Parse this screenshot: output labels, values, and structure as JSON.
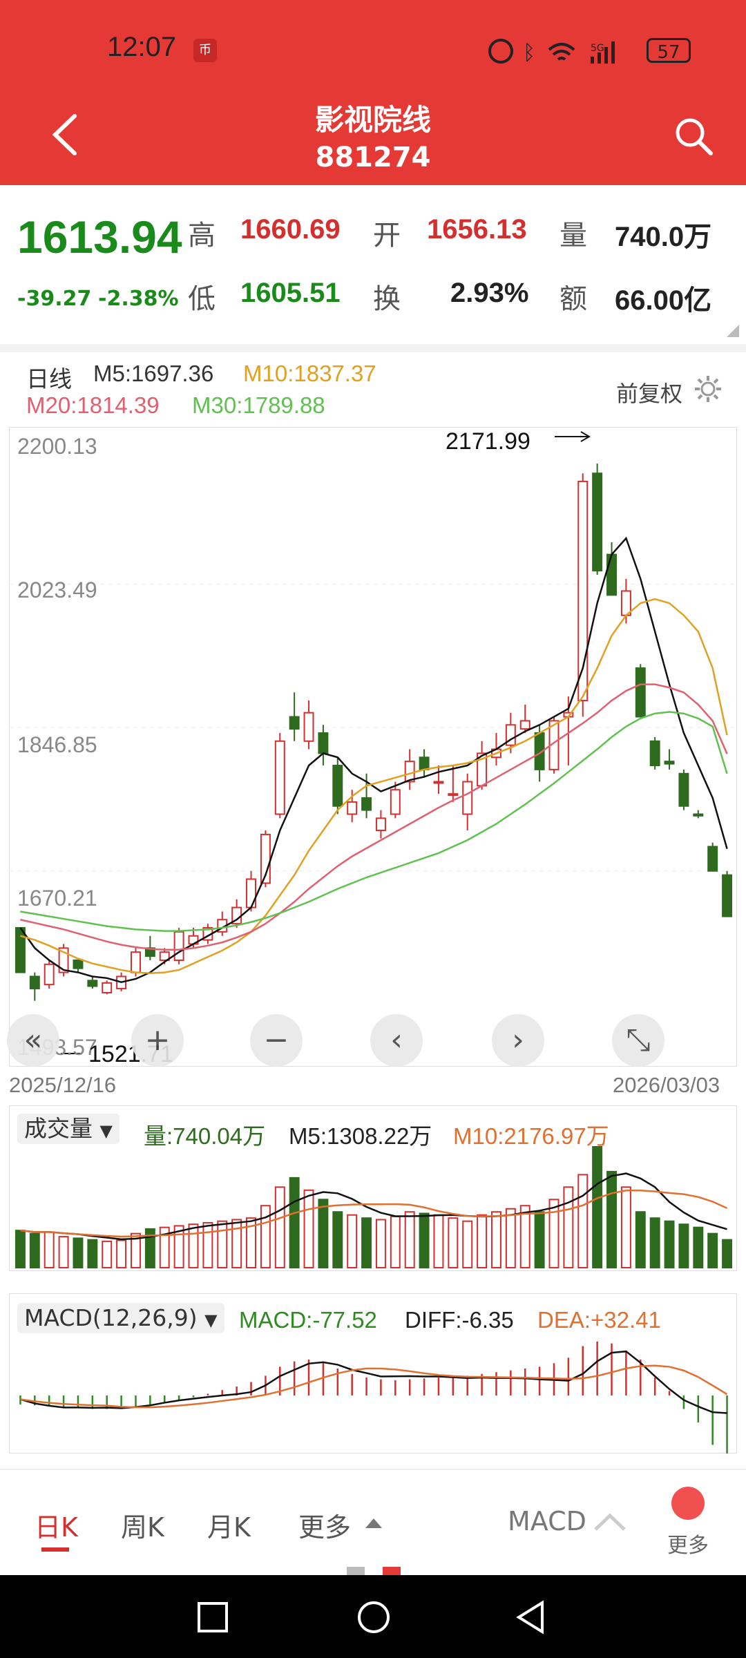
{
  "status": {
    "time": "12:07",
    "battery": "57"
  },
  "header": {
    "title": "影视院线",
    "code": "881274"
  },
  "quote": {
    "price": "1613.94",
    "change": "-39.27",
    "change_pct": "-2.38%",
    "high_label": "高",
    "high": "1660.69",
    "open_label": "开",
    "open": "1656.13",
    "volume_label": "量",
    "volume": "740.0万",
    "low_label": "低",
    "low": "1605.51",
    "turnover_label": "换",
    "turnover": "2.93%",
    "amount_label": "额",
    "amount": "66.00亿"
  },
  "kline": {
    "period": "日线",
    "m5": "M5:1697.36",
    "m10": "M10:1837.37",
    "m20": "M20:1814.39",
    "m30": "M30:1789.88",
    "adjust": "前复权",
    "y_ticks": [
      "2200.13",
      "2023.49",
      "1846.85",
      "1670.21",
      "1493.57"
    ],
    "max_label": "2171.99",
    "min_label": "1521.71",
    "start_date": "2025/12/16",
    "end_date": "2026/03/03"
  },
  "volume_panel": {
    "selector": "成交量",
    "vol": "量:740.04万",
    "m5": "M5:1308.22万",
    "m10": "M10:2176.97万"
  },
  "macd_panel": {
    "selector": "MACD(12,26,9)",
    "macd": "MACD:-77.52",
    "diff": "DIFF:-6.35",
    "dea": "DEA:+32.41"
  },
  "tabs": {
    "day": "日K",
    "week": "周K",
    "month": "月K",
    "more": "更多",
    "indicator": "MACD",
    "more2": "更多"
  },
  "colors": {
    "up": "#d32f2f",
    "down": "#2e6b1f",
    "ma5": "#111111",
    "ma10": "#e0a020",
    "ma20": "#e06070",
    "ma30": "#60c050",
    "header": "#e53935"
  },
  "chart_data": {
    "type": "candlestick",
    "ylim": [
      1493.57,
      2200.13
    ],
    "ohlc": [
      [
        1600,
        1600,
        1545,
        1545
      ],
      [
        1540,
        1545,
        1510,
        1525
      ],
      [
        1530,
        1560,
        1525,
        1555
      ],
      [
        1545,
        1580,
        1540,
        1575
      ],
      [
        1560,
        1560,
        1545,
        1550
      ],
      [
        1535,
        1540,
        1525,
        1528
      ],
      [
        1520,
        1535,
        1518,
        1532
      ],
      [
        1525,
        1545,
        1521.71,
        1540
      ],
      [
        1545,
        1575,
        1540,
        1570
      ],
      [
        1575,
        1590,
        1560,
        1565
      ],
      [
        1560,
        1575,
        1555,
        1570
      ],
      [
        1560,
        1600,
        1555,
        1595
      ],
      [
        1580,
        1600,
        1575,
        1590
      ],
      [
        1585,
        1605,
        1580,
        1600
      ],
      [
        1595,
        1620,
        1590,
        1610
      ],
      [
        1605,
        1635,
        1600,
        1625
      ],
      [
        1625,
        1670,
        1620,
        1660
      ],
      [
        1655,
        1720,
        1650,
        1715
      ],
      [
        1740,
        1840,
        1735,
        1830
      ],
      [
        1860,
        1890,
        1830,
        1845
      ],
      [
        1830,
        1880,
        1820,
        1865
      ],
      [
        1840,
        1850,
        1800,
        1815
      ],
      [
        1800,
        1810,
        1740,
        1750
      ],
      [
        1740,
        1770,
        1730,
        1755
      ],
      [
        1760,
        1790,
        1735,
        1745
      ],
      [
        1720,
        1745,
        1710,
        1735
      ],
      [
        1740,
        1780,
        1735,
        1770
      ],
      [
        1780,
        1820,
        1770,
        1805
      ],
      [
        1810,
        1820,
        1785,
        1795
      ],
      [
        1780,
        1800,
        1765,
        1780
      ],
      [
        1765,
        1800,
        1755,
        1765
      ],
      [
        1740,
        1790,
        1720,
        1780
      ],
      [
        1775,
        1830,
        1770,
        1815
      ],
      [
        1810,
        1840,
        1800,
        1820
      ],
      [
        1825,
        1865,
        1815,
        1850
      ],
      [
        1845,
        1875,
        1840,
        1855
      ],
      [
        1840,
        1850,
        1780,
        1795
      ],
      [
        1795,
        1860,
        1790,
        1855
      ],
      [
        1860,
        1885,
        1800,
        1865
      ],
      [
        1880,
        2160,
        1860,
        2150
      ],
      [
        2160,
        2171.99,
        2035,
        2040
      ],
      [
        2060,
        2075,
        2010,
        2010
      ],
      [
        1985,
        2030,
        1975,
        2015
      ],
      [
        1920,
        1925,
        1865,
        1860
      ],
      [
        1830,
        1835,
        1795,
        1800
      ],
      [
        1805,
        1820,
        1795,
        1802
      ],
      [
        1790,
        1795,
        1745,
        1750
      ],
      [
        1740,
        1745,
        1735,
        1738
      ],
      [
        1700,
        1705,
        1670,
        1670
      ],
      [
        1665,
        1670,
        1615,
        1613.94
      ]
    ],
    "series": [
      {
        "name": "M5",
        "values": [
          1600,
          1575,
          1560,
          1548,
          1545,
          1540,
          1538,
          1533,
          1537,
          1545,
          1558,
          1570,
          1580,
          1590,
          1600,
          1610,
          1625,
          1665,
          1720,
          1760,
          1800,
          1815,
          1810,
          1790,
          1780,
          1768,
          1775,
          1782,
          1786,
          1792,
          1796,
          1800,
          1812,
          1820,
          1832,
          1842,
          1850,
          1860,
          1870,
          1920,
          2000,
          2060,
          2080,
          2030,
          1965,
          1900,
          1840,
          1800,
          1760,
          1697.36
        ]
      },
      {
        "name": "M10",
        "values": [
          1590,
          1585,
          1578,
          1570,
          1562,
          1556,
          1552,
          1548,
          1545,
          1544,
          1545,
          1548,
          1556,
          1564,
          1572,
          1582,
          1595,
          1615,
          1640,
          1665,
          1695,
          1720,
          1745,
          1762,
          1775,
          1780,
          1785,
          1790,
          1795,
          1798,
          1800,
          1803,
          1808,
          1815,
          1822,
          1830,
          1840,
          1850,
          1860,
          1885,
          1920,
          1960,
          1985,
          2000,
          2005,
          2000,
          1985,
          1965,
          1920,
          1837.37
        ]
      },
      {
        "name": "M20",
        "values": [
          1610,
          1606,
          1602,
          1598,
          1593,
          1588,
          1583,
          1579,
          1576,
          1574,
          1573,
          1573,
          1575,
          1578,
          1582,
          1588,
          1595,
          1605,
          1618,
          1632,
          1648,
          1662,
          1676,
          1688,
          1698,
          1708,
          1718,
          1728,
          1738,
          1748,
          1757,
          1765,
          1775,
          1785,
          1795,
          1805,
          1815,
          1828,
          1840,
          1852,
          1865,
          1880,
          1892,
          1900,
          1900,
          1896,
          1890,
          1875,
          1855,
          1814.39
        ]
      },
      {
        "name": "M30",
        "values": [
          1620,
          1617,
          1614,
          1611,
          1608,
          1605,
          1602,
          1600,
          1598,
          1597,
          1596,
          1596,
          1597,
          1598,
          1600,
          1603,
          1607,
          1612,
          1618,
          1625,
          1632,
          1640,
          1648,
          1655,
          1662,
          1668,
          1674,
          1680,
          1686,
          1692,
          1700,
          1708,
          1718,
          1728,
          1740,
          1752,
          1765,
          1778,
          1792,
          1806,
          1820,
          1835,
          1848,
          1858,
          1864,
          1866,
          1864,
          1858,
          1848,
          1789.88
        ]
      }
    ],
    "volume": [
      120,
      110,
      115,
      100,
      95,
      90,
      85,
      88,
      110,
      125,
      130,
      135,
      140,
      145,
      150,
      155,
      160,
      200,
      260,
      290,
      250,
      220,
      180,
      170,
      160,
      155,
      165,
      180,
      175,
      170,
      160,
      150,
      170,
      180,
      190,
      200,
      180,
      220,
      260,
      300,
      390,
      310,
      260,
      180,
      160,
      150,
      140,
      130,
      110,
      90
    ],
    "macd": [
      -10,
      -11,
      -12,
      -13,
      -14,
      -15,
      -15,
      -14,
      -12,
      -10,
      -8,
      -5,
      -2,
      2,
      6,
      10,
      15,
      22,
      32,
      38,
      40,
      36,
      30,
      24,
      20,
      18,
      17,
      18,
      19,
      20,
      21,
      22,
      24,
      26,
      28,
      30,
      32,
      36,
      42,
      55,
      60,
      58,
      50,
      40,
      20,
      5,
      -15,
      -30,
      -55,
      -77.52
    ]
  }
}
